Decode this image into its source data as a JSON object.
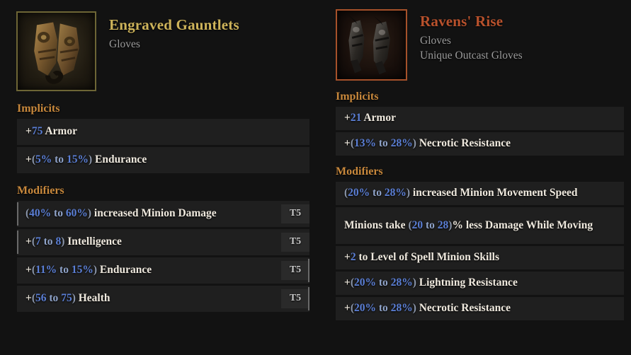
{
  "colors": {
    "background": "#121212",
    "row_background": "#1f1f1f",
    "section_header": "#c8883c",
    "rare_name": "#cdb35a",
    "unique_name": "#b8512c",
    "value_blue": "#5b7fd6",
    "tier_badge_bg": "#2a2a2a"
  },
  "left_item": {
    "name": "Engraved Gauntlets",
    "base_type": "Gloves",
    "icon": "gauntlets-icon",
    "sections": {
      "implicits_label": "Implicits",
      "modifiers_label": "Modifiers"
    },
    "implicits": [
      {
        "parts": [
          {
            "text": "+",
            "style": "plus"
          },
          {
            "text": "75",
            "style": "v"
          },
          {
            "text": " Armor",
            "style": "lit"
          }
        ],
        "plain": "+75 Armor",
        "tier": ""
      },
      {
        "parts": [
          {
            "text": "+",
            "style": "plus"
          },
          {
            "text": "(",
            "style": "paren"
          },
          {
            "text": "5%",
            "style": "v"
          },
          {
            "text": " to ",
            "style": "v-dim"
          },
          {
            "text": "15%",
            "style": "v"
          },
          {
            "text": ")",
            "style": "paren"
          },
          {
            "text": " Endurance",
            "style": "lit"
          }
        ],
        "plain": "+(5% to 15%) Endurance",
        "tier": ""
      }
    ],
    "modifiers": [
      {
        "parts": [
          {
            "text": "(",
            "style": "paren"
          },
          {
            "text": "40%",
            "style": "v"
          },
          {
            "text": " to ",
            "style": "v-dim"
          },
          {
            "text": "60%",
            "style": "v"
          },
          {
            "text": ")",
            "style": "paren"
          },
          {
            "text": " increased Minion Damage",
            "style": "lit"
          }
        ],
        "plain": "(40% to 60%) increased Minion Damage",
        "tier": "T5",
        "accent": "left"
      },
      {
        "parts": [
          {
            "text": "+",
            "style": "plus"
          },
          {
            "text": "(",
            "style": "paren"
          },
          {
            "text": "7",
            "style": "v"
          },
          {
            "text": " to ",
            "style": "v-dim"
          },
          {
            "text": "8",
            "style": "v"
          },
          {
            "text": ")",
            "style": "paren"
          },
          {
            "text": " Intelligence",
            "style": "lit"
          }
        ],
        "plain": "+(7 to 8) Intelligence",
        "tier": "T5",
        "accent": "left"
      },
      {
        "parts": [
          {
            "text": "+",
            "style": "plus"
          },
          {
            "text": "(",
            "style": "paren"
          },
          {
            "text": "11%",
            "style": "v"
          },
          {
            "text": " to ",
            "style": "v-dim"
          },
          {
            "text": "15%",
            "style": "v"
          },
          {
            "text": ")",
            "style": "paren"
          },
          {
            "text": " Endurance",
            "style": "lit"
          }
        ],
        "plain": "+(11% to 15%) Endurance",
        "tier": "T5",
        "accent": "right"
      },
      {
        "parts": [
          {
            "text": "+",
            "style": "plus"
          },
          {
            "text": "(",
            "style": "paren"
          },
          {
            "text": "56",
            "style": "v"
          },
          {
            "text": " to ",
            "style": "v-dim"
          },
          {
            "text": "75",
            "style": "v"
          },
          {
            "text": ")",
            "style": "paren"
          },
          {
            "text": " Health",
            "style": "lit"
          }
        ],
        "plain": "+(56 to 75) Health",
        "tier": "T5",
        "accent": "right"
      }
    ]
  },
  "right_item": {
    "name": "Ravens' Rise",
    "base_type": "Gloves",
    "rarity_line": "Unique Outcast Gloves",
    "icon": "ravens-rise-gloves-icon",
    "sections": {
      "implicits_label": "Implicits",
      "modifiers_label": "Modifiers"
    },
    "implicits": [
      {
        "parts": [
          {
            "text": "+",
            "style": "plus"
          },
          {
            "text": "21",
            "style": "v"
          },
          {
            "text": " Armor",
            "style": "lit"
          }
        ],
        "plain": "+21 Armor",
        "tier": ""
      },
      {
        "parts": [
          {
            "text": "+",
            "style": "plus"
          },
          {
            "text": "(",
            "style": "paren"
          },
          {
            "text": "13%",
            "style": "v"
          },
          {
            "text": " to ",
            "style": "v-dim"
          },
          {
            "text": "28%",
            "style": "v"
          },
          {
            "text": ")",
            "style": "paren"
          },
          {
            "text": " Necrotic Resistance",
            "style": "lit"
          }
        ],
        "plain": "+(13% to 28%) Necrotic Resistance",
        "tier": ""
      }
    ],
    "modifiers": [
      {
        "parts": [
          {
            "text": "(",
            "style": "paren"
          },
          {
            "text": "20%",
            "style": "v"
          },
          {
            "text": " to ",
            "style": "v-dim"
          },
          {
            "text": "28%",
            "style": "v"
          },
          {
            "text": ")",
            "style": "paren"
          },
          {
            "text": " increased Minion Movement Speed",
            "style": "lit"
          }
        ],
        "plain": "(20% to 28%) increased Minion Movement Speed",
        "tier": ""
      },
      {
        "parts": [
          {
            "text": "Minions take ",
            "style": "lit"
          },
          {
            "text": "(",
            "style": "paren"
          },
          {
            "text": "20",
            "style": "v"
          },
          {
            "text": " to ",
            "style": "v-dim"
          },
          {
            "text": "28",
            "style": "v"
          },
          {
            "text": ")",
            "style": "paren"
          },
          {
            "text": "% less Damage While Moving",
            "style": "lit"
          }
        ],
        "plain": "Minions take (20 to 28)% less Damage While Moving",
        "tier": "",
        "tall": true
      },
      {
        "parts": [
          {
            "text": "+",
            "style": "plus"
          },
          {
            "text": "2",
            "style": "v"
          },
          {
            "text": " to Level of Spell Minion Skills",
            "style": "lit"
          }
        ],
        "plain": "+2 to Level of Spell Minion Skills",
        "tier": ""
      },
      {
        "parts": [
          {
            "text": "+",
            "style": "plus"
          },
          {
            "text": "(",
            "style": "paren"
          },
          {
            "text": "20%",
            "style": "v"
          },
          {
            "text": " to ",
            "style": "v-dim"
          },
          {
            "text": "28%",
            "style": "v"
          },
          {
            "text": ")",
            "style": "paren"
          },
          {
            "text": " Lightning Resistance",
            "style": "lit"
          }
        ],
        "plain": "+(20% to 28%) Lightning Resistance",
        "tier": ""
      },
      {
        "parts": [
          {
            "text": "+",
            "style": "plus"
          },
          {
            "text": "(",
            "style": "paren"
          },
          {
            "text": "20%",
            "style": "v"
          },
          {
            "text": " to ",
            "style": "v-dim"
          },
          {
            "text": "28%",
            "style": "v"
          },
          {
            "text": ")",
            "style": "paren"
          },
          {
            "text": " Necrotic Resistance",
            "style": "lit"
          }
        ],
        "plain": "+(20% to 28%) Necrotic Resistance",
        "tier": ""
      }
    ]
  }
}
